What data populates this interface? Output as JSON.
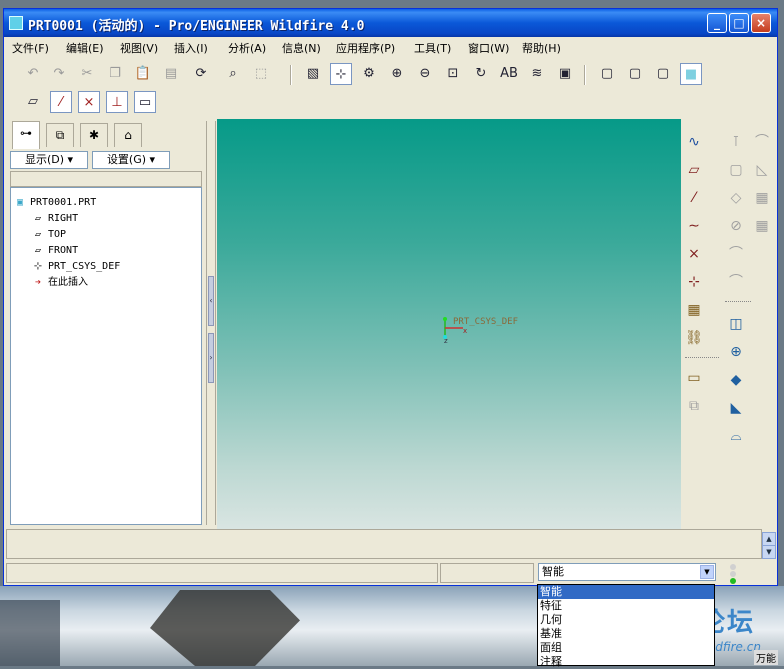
{
  "window": {
    "title": "PRT0001 (活动的) - Pro/ENGINEER Wildfire 4.0",
    "min": "_",
    "max": "□",
    "close": "×"
  },
  "menu": [
    "文件(F)",
    "编辑(E)",
    "视图(V)",
    "插入(I)",
    "分析(A)",
    "信息(N)",
    "应用程序(P)",
    "工具(T)",
    "窗口(W)",
    "帮助(H)"
  ],
  "toolbar_icons": {
    "undo": "↶",
    "redo": "↷",
    "cut": "✂",
    "copy": "❐",
    "paste": "📋",
    "paste_special": "▤",
    "regenerate": "⟳",
    "find": "⌕",
    "select_box": "⬚",
    "repaint": "▧",
    "spin_center": "⊹",
    "orient": "⚙",
    "zoom_in": "⊕",
    "zoom_out": "⊖",
    "refit": "⊡",
    "reorient": "↻",
    "saved_views": "AB",
    "layers": "≋",
    "view_manager": "▣",
    "wireframe": "▢",
    "hidden_line": "▢",
    "no_hidden": "▢",
    "shading": "■",
    "datum_plane_display": "▱",
    "datum_axis_display": "⁄",
    "datum_point_display": "×",
    "csys_display": "⊥",
    "annotation_display": "▭"
  },
  "nav_tabs": [
    "⊶",
    "⧉",
    "✱",
    "⌂"
  ],
  "left_panel": {
    "show_label": "显示(D) ▾",
    "settings_label": "设置(G) ▾"
  },
  "tree": [
    {
      "icon": "▣",
      "label": "PRT0001.PRT"
    },
    {
      "icon": "▱",
      "label": "RIGHT"
    },
    {
      "icon": "▱",
      "label": "TOP"
    },
    {
      "icon": "▱",
      "label": "FRONT"
    },
    {
      "icon": "⊹",
      "label": "PRT_CSYS_DEF"
    },
    {
      "icon": "➔",
      "label": "在此插入"
    }
  ],
  "graphics": {
    "csys_label": "PRT_CSYS_DEF",
    "axis_z": "z",
    "axis_x": "x"
  },
  "right_toolbar": {
    "sketch": "∿",
    "plane": "▱",
    "axis": "⁄",
    "curve": "∼",
    "point": "×",
    "csys": "⊹",
    "analysis": "▦",
    "chain": "⛓",
    "note": "▭",
    "group": "⧉",
    "hole": "⊺",
    "round": "⌒",
    "shell": "▢",
    "rib": "◺",
    "draft": "◇",
    "pattern": "▦",
    "mirror": "⊘",
    "extrude": "◫",
    "revolve": "⊕",
    "sweep": "◆",
    "blend": "◣",
    "boundary": "⌓",
    "swept_blend": "⌒"
  },
  "status": {
    "filter_value": "智能",
    "filter_options": [
      "智能",
      "特征",
      "几何",
      "基准",
      "面组",
      "注释"
    ]
  },
  "watermark": {
    "text": "野火论坛",
    "url": "www.proewildfire.cn"
  },
  "corner_text": "万能"
}
